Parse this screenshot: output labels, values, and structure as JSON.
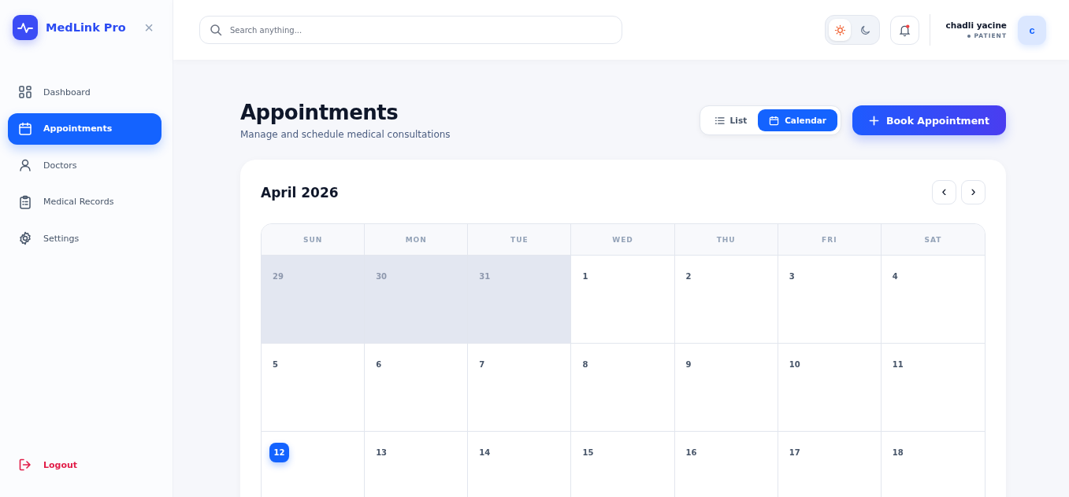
{
  "sidebar": {
    "brand": "MedLink Pro",
    "close": "×",
    "items": [
      {
        "label": "Dashboard",
        "selected": false
      },
      {
        "label": "Appointments",
        "selected": true
      },
      {
        "label": "Doctors",
        "selected": false
      },
      {
        "label": "Medical Records",
        "selected": false
      },
      {
        "label": "Settings",
        "selected": false
      }
    ],
    "logout": "Logout"
  },
  "header": {
    "search": {
      "placeholder": "Search anything..."
    },
    "theme": [
      {
        "selected": true
      },
      {
        "selected": false
      }
    ],
    "notifications": {
      "unread": true
    },
    "user": {
      "name": "chadli yacine",
      "role": "PATIENT",
      "avatar": "c"
    }
  },
  "page": {
    "title": "Appointments",
    "subtitle": "Manage and schedule medical consultations",
    "views": [
      {
        "label": "List",
        "selected": false
      },
      {
        "label": "Calendar",
        "selected": true
      }
    ],
    "book_button": "Book Appointment"
  },
  "calendar": {
    "month": "April 2026",
    "prev": "‹",
    "next": "›",
    "weekdays": [
      "SUN",
      "MON",
      "TUE",
      "WED",
      "THU",
      "FRI",
      "SAT"
    ],
    "weeks": [
      [
        {
          "day": "29",
          "muted": true,
          "today": false
        },
        {
          "day": "30",
          "muted": true,
          "today": false
        },
        {
          "day": "31",
          "muted": true,
          "today": false
        },
        {
          "day": "1",
          "muted": false,
          "today": false
        },
        {
          "day": "2",
          "muted": false,
          "today": false
        },
        {
          "day": "3",
          "muted": false,
          "today": false
        },
        {
          "day": "4",
          "muted": false,
          "today": false
        }
      ],
      [
        {
          "day": "5",
          "muted": false,
          "today": false
        },
        {
          "day": "6",
          "muted": false,
          "today": false
        },
        {
          "day": "7",
          "muted": false,
          "today": false
        },
        {
          "day": "8",
          "muted": false,
          "today": false
        },
        {
          "day": "9",
          "muted": false,
          "today": false
        },
        {
          "day": "10",
          "muted": false,
          "today": false
        },
        {
          "day": "11",
          "muted": false,
          "today": false
        }
      ],
      [
        {
          "day": "12",
          "muted": false,
          "today": true
        },
        {
          "day": "13",
          "muted": false,
          "today": false
        },
        {
          "day": "14",
          "muted": false,
          "today": false
        },
        {
          "day": "15",
          "muted": false,
          "today": false
        },
        {
          "day": "16",
          "muted": false,
          "today": false
        },
        {
          "day": "17",
          "muted": false,
          "today": false
        },
        {
          "day": "18",
          "muted": false,
          "today": false
        }
      ]
    ]
  }
}
